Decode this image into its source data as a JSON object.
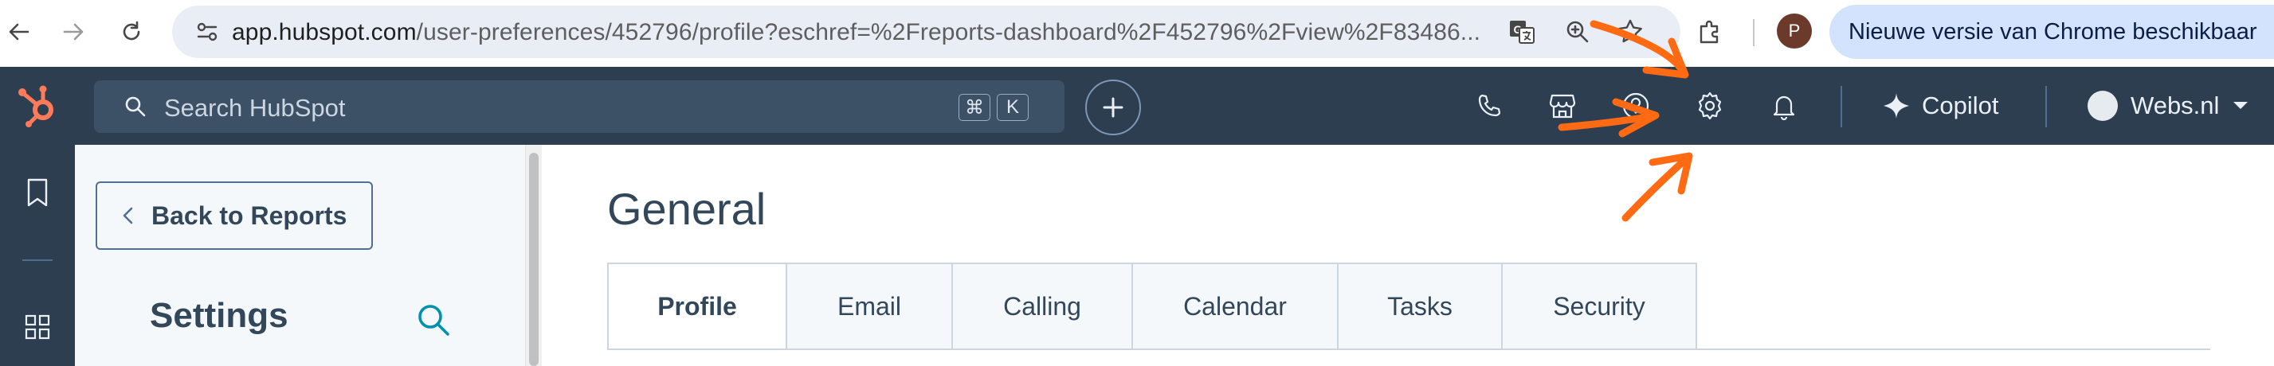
{
  "browser": {
    "url_host": "app.hubspot.com",
    "url_path": "/user-preferences/452796/profile?eschref=%2Freports-dashboard%2F452796%2Fview%2F83486...",
    "profile_initial": "P",
    "update_banner": "Nieuwe versie van Chrome beschikbaar",
    "icons": [
      "back-arrow-icon",
      "forward-arrow-icon",
      "reload-icon",
      "site-info-icon",
      "translate-icon",
      "zoom-icon",
      "bookmark-star-icon",
      "extensions-icon",
      "more-menu-icon"
    ]
  },
  "hubspot_nav": {
    "search_placeholder": "Search HubSpot",
    "shortcut_key1": "⌘",
    "shortcut_key2": "K",
    "copilot_label": "Copilot",
    "account_label": "Webs.nl",
    "icons": [
      "hubspot-logo",
      "search-icon",
      "plus-icon",
      "phone-icon",
      "marketplace-icon",
      "help-icon",
      "settings-gear-icon",
      "notifications-bell-icon",
      "copilot-sparkle-icon",
      "chevron-down-icon"
    ]
  },
  "rail": {
    "icons": [
      "bookmark-icon",
      "grid-icon"
    ]
  },
  "sidebar": {
    "back_label": "Back to Reports",
    "title": "Settings"
  },
  "main": {
    "title": "General",
    "tabs": [
      {
        "label": "Profile",
        "active": true
      },
      {
        "label": "Email",
        "active": false
      },
      {
        "label": "Calling",
        "active": false
      },
      {
        "label": "Calendar",
        "active": false
      },
      {
        "label": "Tasks",
        "active": false
      },
      {
        "label": "Security",
        "active": false
      }
    ]
  },
  "colors": {
    "hubspot_navy": "#2d3e50",
    "hubspot_orange": "#ff7a59",
    "annotation_arrow": "#ff6a13",
    "text_dark": "#33475b",
    "search_teal": "#0091ae"
  }
}
